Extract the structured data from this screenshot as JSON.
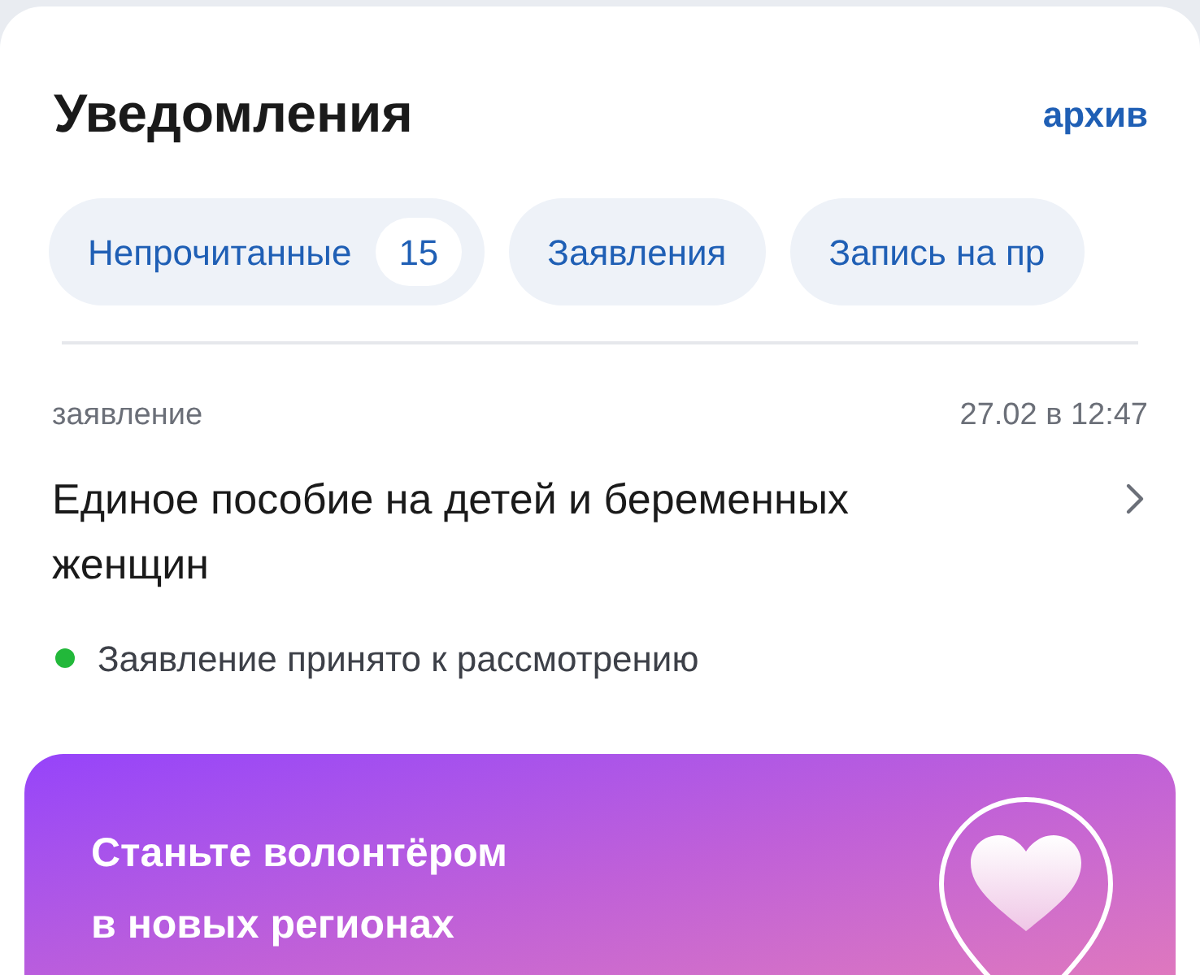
{
  "header": {
    "title": "Уведомления",
    "archive_link": "архив"
  },
  "tabs": [
    {
      "label": "Непрочитанные",
      "count": "15"
    },
    {
      "label": "Заявления"
    },
    {
      "label": "Запись на пр"
    }
  ],
  "notification": {
    "category": "заявление",
    "time": "27.02 в 12:47",
    "title": "Единое пособие на детей и беременных женщин",
    "status": {
      "text": "Заявление принято к рассмотрению",
      "color": "#22b83a"
    }
  },
  "banner": {
    "lines": [
      "Станьте волонтёром",
      "в новых регионах"
    ]
  }
}
